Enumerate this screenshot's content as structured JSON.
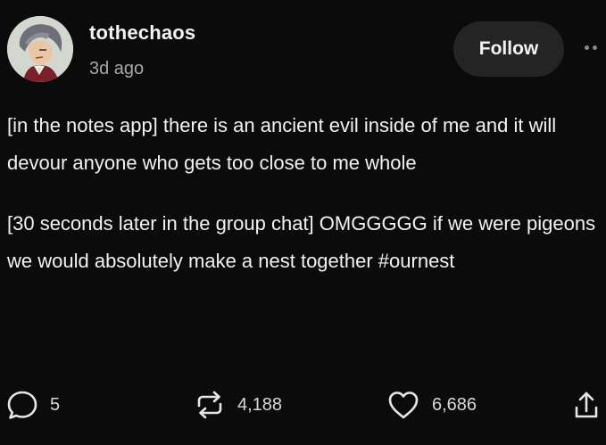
{
  "header": {
    "username": "tothechaos",
    "timestamp": "3d ago",
    "follow_label": "Follow"
  },
  "body": {
    "paragraphs": [
      "[in the notes app] there is an ancient evil inside of me and it will devour anyone who gets too close to me whole",
      "[30 seconds later in the group chat] OMGGGGG if we were pigeons we would absolutely make a nest together #ournest"
    ]
  },
  "footer": {
    "replies": "5",
    "reblogs": "4,188",
    "likes": "6,686"
  },
  "icons": {
    "reply": "speech-bubble-icon",
    "reblog": "reblog-arrows-icon",
    "like": "heart-icon",
    "share": "share-upload-icon",
    "more": "more-dots-icon"
  },
  "colors": {
    "background": "#0b0b0b",
    "text": "#f2f2f2",
    "muted": "#a8a8a8",
    "button": "#242424"
  }
}
